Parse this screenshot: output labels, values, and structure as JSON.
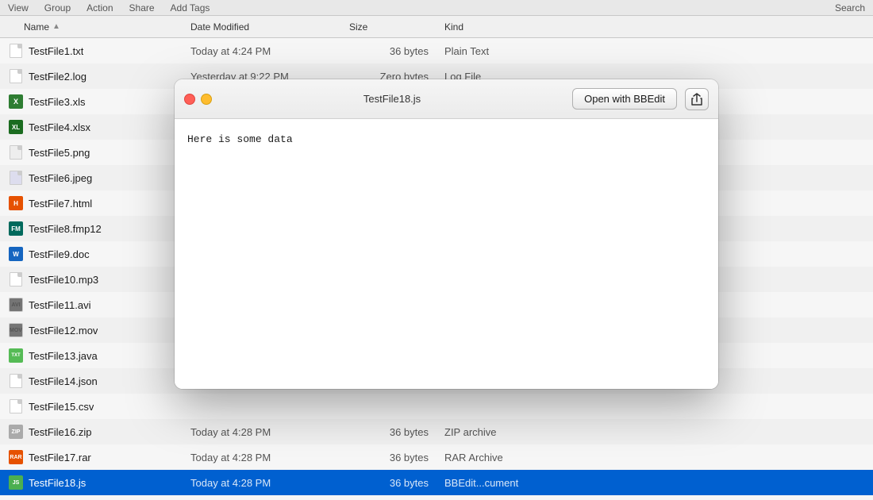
{
  "toolbar": {
    "items": [
      "View",
      "Group",
      "Action",
      "Share",
      "Add Tags",
      "Search"
    ]
  },
  "columns": {
    "name": "Name",
    "date_modified": "Date Modified",
    "size": "Size",
    "kind": "Kind"
  },
  "files": [
    {
      "id": 1,
      "name": "TestFile1.txt",
      "date": "Today at 4:24 PM",
      "size": "36 bytes",
      "kind": "Plain Text",
      "icon": "txt"
    },
    {
      "id": 2,
      "name": "TestFile2.log",
      "date": "Yesterday at 9:22 PM",
      "size": "Zero bytes",
      "kind": "Log File",
      "icon": "log"
    },
    {
      "id": 3,
      "name": "TestFile3.xls",
      "date": "",
      "size": "",
      "kind": "",
      "icon": "xls"
    },
    {
      "id": 4,
      "name": "TestFile4.xlsx",
      "date": "",
      "size": "",
      "kind": "",
      "icon": "xlsx"
    },
    {
      "id": 5,
      "name": "TestFile5.png",
      "date": "",
      "size": "",
      "kind": "",
      "icon": "png"
    },
    {
      "id": 6,
      "name": "TestFile6.jpeg",
      "date": "",
      "size": "",
      "kind": "",
      "icon": "jpeg"
    },
    {
      "id": 7,
      "name": "TestFile7.html",
      "date": "",
      "size": "",
      "kind": "",
      "icon": "html"
    },
    {
      "id": 8,
      "name": "TestFile8.fmp12",
      "date": "",
      "size": "",
      "kind": "",
      "icon": "fmp12"
    },
    {
      "id": 9,
      "name": "TestFile9.doc",
      "date": "",
      "size": "",
      "kind": "",
      "icon": "doc"
    },
    {
      "id": 10,
      "name": "TestFile10.mp3",
      "date": "",
      "size": "",
      "kind": "",
      "icon": "mp3"
    },
    {
      "id": 11,
      "name": "TestFile11.avi",
      "date": "",
      "size": "",
      "kind": "",
      "icon": "avi"
    },
    {
      "id": 12,
      "name": "TestFile12.mov",
      "date": "",
      "size": "",
      "kind": "",
      "icon": "mov"
    },
    {
      "id": 13,
      "name": "TestFile13.java",
      "date": "",
      "size": "",
      "kind": "",
      "icon": "java"
    },
    {
      "id": 14,
      "name": "TestFile14.json",
      "date": "",
      "size": "",
      "kind": "",
      "icon": "json"
    },
    {
      "id": 15,
      "name": "TestFile15.csv",
      "date": "",
      "size": "",
      "kind": "",
      "icon": "csv"
    },
    {
      "id": 16,
      "name": "TestFile16.zip",
      "date": "Today at 4:28 PM",
      "size": "36 bytes",
      "kind": "ZIP archive",
      "icon": "zip"
    },
    {
      "id": 17,
      "name": "TestFile17.rar",
      "date": "Today at 4:28 PM",
      "size": "36 bytes",
      "kind": "RAR Archive",
      "icon": "rar"
    },
    {
      "id": 18,
      "name": "TestFile18.js",
      "date": "Today at 4:28 PM",
      "size": "36 bytes",
      "kind": "BBEdit...cument",
      "icon": "js"
    }
  ],
  "quicklook": {
    "filename": "TestFile18.js",
    "open_btn_label": "Open with BBEdit",
    "content": "Here is some data",
    "share_icon": "↑"
  }
}
